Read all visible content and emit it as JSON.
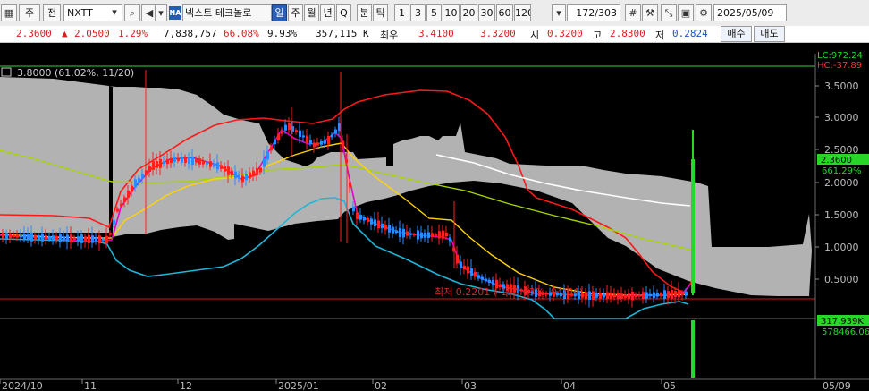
{
  "toolbar": {
    "market_label": "주",
    "period_label": "전",
    "ticker": "NXTT",
    "na_badge": "NA",
    "stock_name": "넥스트 테크놀로",
    "period_buttons": [
      "일",
      "주",
      "월",
      "년",
      "Q",
      "분",
      "틱"
    ],
    "interval_buttons": [
      "1",
      "3",
      "5",
      "10",
      "20",
      "30",
      "60",
      "120"
    ],
    "counter": "172/303",
    "date": "2025/05/09",
    "icons": [
      "search-icon",
      "speaker-icon",
      "grid-icon",
      "tools-icon",
      "zoom-out-icon",
      "save-icon",
      "gear-icon"
    ]
  },
  "infobar": {
    "price": "2.3600",
    "change_arrow": "▲",
    "change": "2.0500",
    "change_pct": "1.29%",
    "volume": "7,838,757",
    "vol_ratio": "66.08%",
    "turnover": "9.93%",
    "amount": "357,115 K",
    "min_label": "최우",
    "min_val1": "3.4100",
    "min_val2": "3.3200",
    "open_label": "시",
    "open_val": "0.3200",
    "high_label": "고",
    "high_val": "2.8300",
    "low_label": "저",
    "low_val": "0.2824",
    "buy_button": "매수",
    "sell_button": "매도"
  },
  "chart_header": "3.8000 (61.02%, 11/20)",
  "right_labels": {
    "lc": "LC:972.24",
    "hc": "HC:-37.89",
    "price_box": "2.3600",
    "price_pct": "661.29%",
    "vol_box": "317,939K",
    "vol_sub": "578466.06"
  },
  "low_annotation": "최저 0.2201 (-190.63%, 04/04)",
  "chart_data": {
    "type": "candlestick",
    "y_ticks": [
      "3.5000",
      "3.0000",
      "2.5000",
      "2.0000",
      "1.5000",
      "1.0000",
      "0.5000"
    ],
    "x_ticks": [
      "2024/10",
      "11",
      "12",
      "2025/01",
      "02",
      "03",
      "04",
      "05",
      "05/09"
    ],
    "colors": {
      "up": "#ff2020",
      "down": "#2a8cff",
      "ma5": "#e000c8",
      "ma20": "#ffd400",
      "ma60": "#a8d400",
      "ma120": "#ffffff",
      "bb": "#ff1818",
      "bb_low": "#1eb6d8",
      "cloud": "#bcbcbc",
      "volume": "#27d627"
    }
  }
}
